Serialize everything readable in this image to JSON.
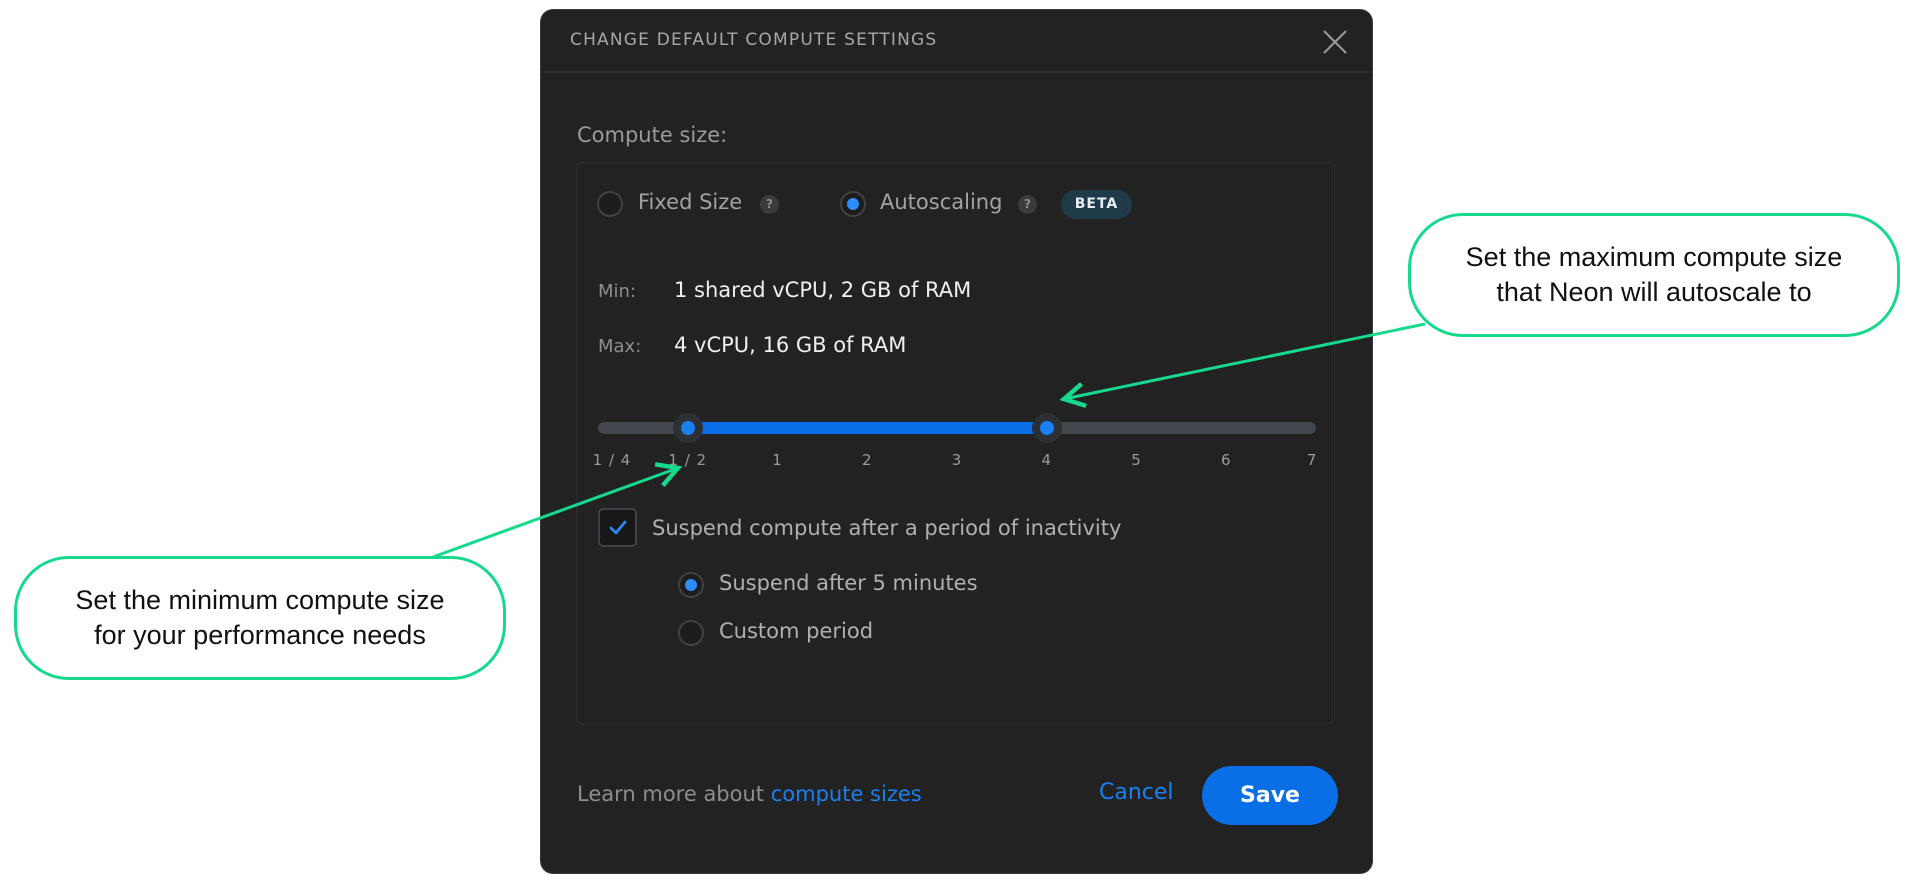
{
  "dialog": {
    "title": "CHANGE DEFAULT COMPUTE SETTINGS",
    "close_icon": "close-icon",
    "compute_size_label": "Compute size:",
    "mode_options": [
      {
        "label": "Fixed Size",
        "selected": false,
        "help": "?"
      },
      {
        "label": "Autoscaling",
        "selected": true,
        "help": "?",
        "badge": "BETA"
      }
    ],
    "min": {
      "key": "Min:",
      "value": "1 shared vCPU, 2 GB of RAM"
    },
    "max": {
      "key": "Max:",
      "value": "4 vCPU, 16 GB of RAM"
    },
    "slider": {
      "ticks": [
        "1 / 4",
        "1 / 2",
        "1",
        "2",
        "3",
        "4",
        "5",
        "6",
        "7"
      ],
      "min_index": 1,
      "max_index": 5,
      "min_value": "1 / 2",
      "max_value": "4"
    },
    "suspend": {
      "checkbox_label": "Suspend compute after a period of inactivity",
      "checked": true,
      "options": [
        {
          "label": "Suspend after 5 minutes",
          "selected": true
        },
        {
          "label": "Custom period",
          "selected": false
        }
      ]
    },
    "footer": {
      "learn_prefix": "Learn more about",
      "learn_link": "compute sizes",
      "cancel_label": "Cancel",
      "save_label": "Save"
    }
  },
  "annotations": {
    "max_callout": "Set the maximum compute size that Neon will autoscale to",
    "max_callout_lines": [
      "Set the maximum compute size",
      "that Neon will autoscale to"
    ],
    "min_callout_lines": [
      "Set the minimum compute size",
      "for your performance needs"
    ]
  },
  "colors": {
    "dialog_bg": "#222223",
    "accent_blue": "#0a6fe6",
    "annotation_green": "#17d98e",
    "badge_bg": "#1f3a48"
  }
}
